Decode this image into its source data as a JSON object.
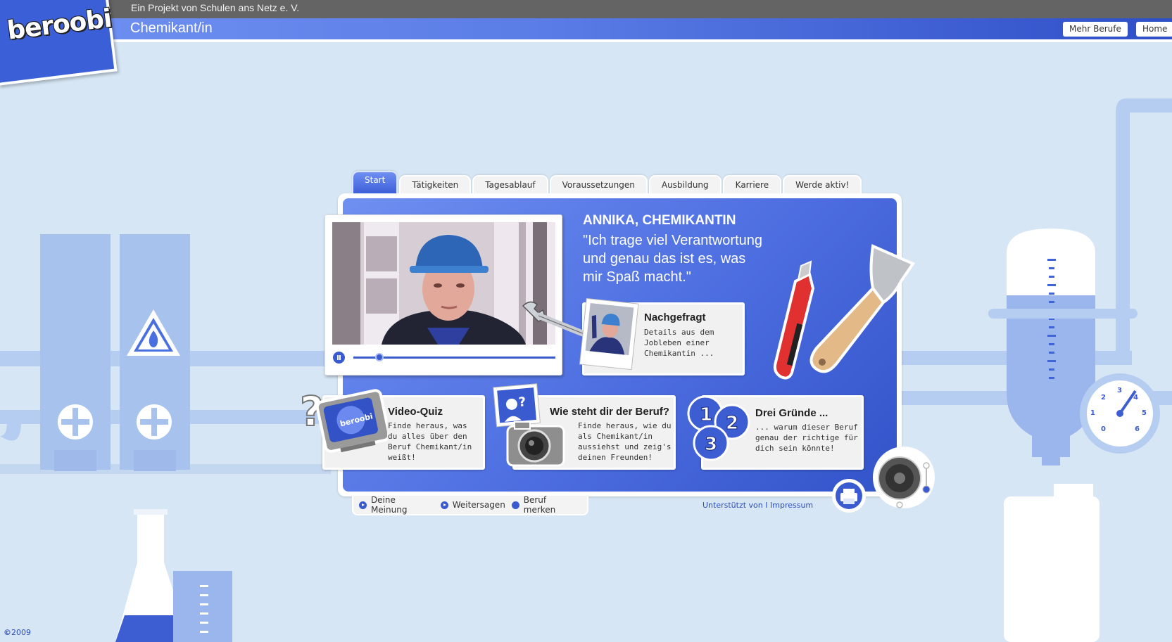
{
  "header": {
    "project_text": "Ein Projekt von Schulen ans Netz e. V.",
    "logo_text": "beroobi",
    "page_title": "Chemikant/in",
    "buttons": {
      "more_jobs": "Mehr Berufe",
      "home": "Home"
    }
  },
  "tabs": [
    {
      "label": "Start",
      "active": true
    },
    {
      "label": "Tätigkeiten"
    },
    {
      "label": "Tagesablauf"
    },
    {
      "label": "Voraussetzungen"
    },
    {
      "label": "Ausbildung"
    },
    {
      "label": "Karriere"
    },
    {
      "label": "Werde aktiv!"
    }
  ],
  "quote": {
    "name": "ANNIKA, CHEMIKANTIN",
    "lines": [
      "\"Ich trage viel Verantwortung",
      "und genau das ist es, was",
      "mir Spaß macht.\""
    ]
  },
  "video": {
    "progress": 0.13
  },
  "cards": {
    "nachgefragt": {
      "title": "Nachgefragt",
      "desc": [
        "Details aus dem",
        "Jobleben einer",
        "Chemikantin ..."
      ]
    },
    "quiz": {
      "title": "Video-Quiz",
      "desc": [
        "Finde heraus, was",
        "du alles über den",
        "Beruf Chemikant/in",
        "weißt!"
      ]
    },
    "photo": {
      "title": "Wie steht dir der Beruf?",
      "desc": [
        "Finde heraus, wie du",
        "als Chemikant/in",
        "aussiehst und zeig's",
        "deinen Freunden!"
      ]
    },
    "reasons": {
      "title": "Drei Gründe ...",
      "desc": [
        "... warum dieser Beruf",
        "genau der richtige für",
        "dich sein könnte!"
      ]
    }
  },
  "badges": {
    "one": "1",
    "two": "2",
    "three": "3"
  },
  "footer": {
    "links": [
      "Deine Meinung",
      "Weitersagen",
      "Beruf merken"
    ],
    "supported": "Unterstützt von",
    "separator": "I",
    "impressum": "Impressum",
    "copyright": "2009"
  },
  "gauge_labels": [
    "1",
    "2",
    "3",
    "4",
    "5",
    "6",
    "0"
  ],
  "colors": {
    "accent": "#3a5bd0",
    "background": "#d6e6f4",
    "panel": "#4d6ee0",
    "topbar": "#646464"
  }
}
